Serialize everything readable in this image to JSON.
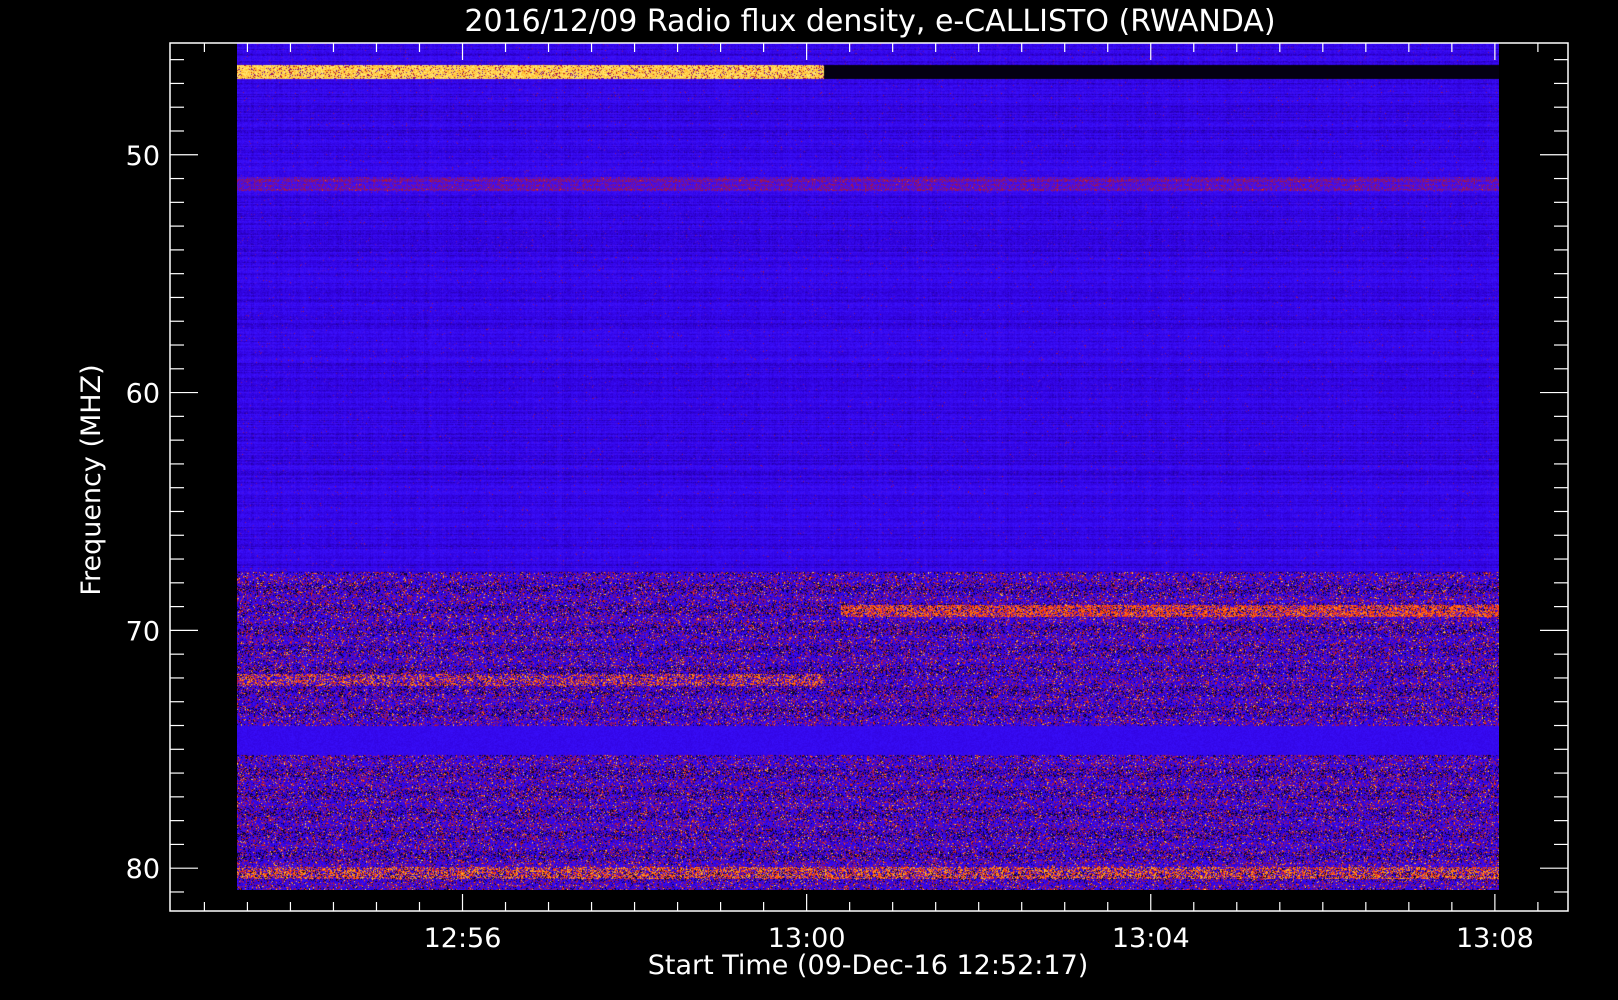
{
  "chart_data": {
    "type": "heatmap",
    "title": "2016/12/09  Radio flux density, e-CALLISTO (RWANDA)",
    "xlabel": "Start Time (09-Dec-16 12:52:17)",
    "ylabel": "Frequency (MHZ)",
    "x_ticks": [
      {
        "minutes": 296,
        "label": "12:56"
      },
      {
        "minutes": 300,
        "label": "13:00"
      },
      {
        "minutes": 304,
        "label": "13:04"
      },
      {
        "minutes": 308,
        "label": "13:08"
      }
    ],
    "y_ticks": [
      {
        "value": 50,
        "label": "50"
      },
      {
        "value": 60,
        "label": "60"
      },
      {
        "value": 70,
        "label": "70"
      },
      {
        "value": 80,
        "label": "80"
      }
    ],
    "xlim_minutes": [
      292.6,
      308.85
    ],
    "ylim_mhz": [
      81.8,
      45.3
    ],
    "data_extent": {
      "t_start_minutes": 293.38,
      "t_end_minutes": 308.05,
      "f_top_mhz": 45.3,
      "f_bottom_mhz": 80.9
    },
    "colormap": [
      "#000000",
      "#1a0070",
      "#2f00d8",
      "#3a10ff",
      "#7a1090",
      "#c01818",
      "#ff3a10",
      "#ffb020",
      "#ffff90"
    ],
    "background": "#000000",
    "foreground": "#ffffff",
    "grid": false,
    "features": [
      {
        "label": "strong interference band",
        "f_mhz": [
          46.2,
          46.8
        ],
        "t_minutes": [
          293.38,
          300.2
        ],
        "level": 0.93
      },
      {
        "label": "dark band",
        "f_mhz": [
          46.2,
          46.8
        ],
        "t_minutes": [
          300.2,
          308.05
        ],
        "level": 0.0
      },
      {
        "label": "weak band",
        "f_mhz": [
          51.0,
          51.5
        ],
        "t_minutes": [
          293.38,
          308.05
        ],
        "level": 0.5
      },
      {
        "label": "mixed interference",
        "f_mhz": [
          67.5,
          81.0
        ],
        "t_minutes": [
          293.38,
          308.05
        ],
        "level": 0.55
      }
    ]
  }
}
